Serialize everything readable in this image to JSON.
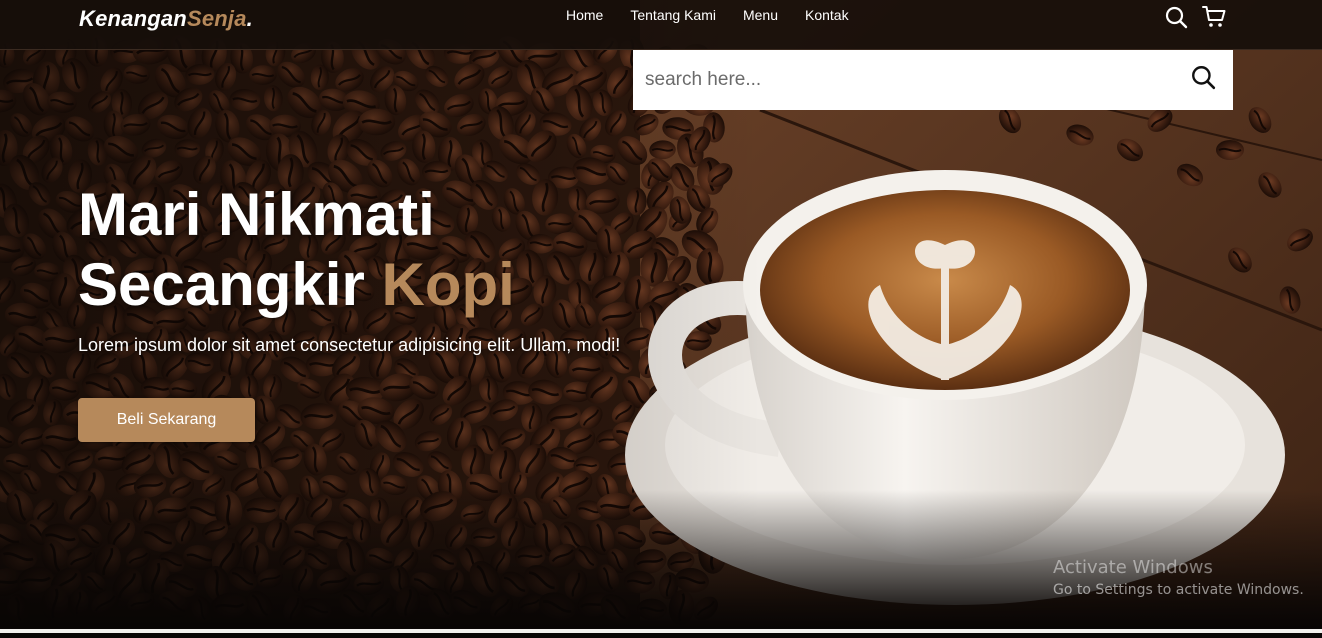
{
  "brand": {
    "name_main": "Kenangan",
    "name_accent": "Senja",
    "name_dot": "."
  },
  "nav": {
    "links": [
      "Home",
      "Tentang Kami",
      "Menu",
      "Kontak"
    ],
    "icons": [
      "search-icon",
      "cart-icon"
    ]
  },
  "search": {
    "placeholder": "search here...",
    "icon": "search-icon"
  },
  "hero": {
    "title_line1": "Mari Nikmati",
    "title_line2_main": "Secangkir ",
    "title_line2_accent": "Kopi",
    "description": "Lorem ipsum dolor sit amet consectetur adipisicing elit. Ullam, modi!",
    "cta_label": "Beli Sekarang"
  },
  "watermark": {
    "title": "Activate Windows",
    "subtitle": "Go to Settings to activate Windows."
  },
  "colors": {
    "accent": "#b6895b",
    "navbar_bg": "#160e0a",
    "text": "#ffffff",
    "search_bg": "#ffffff"
  }
}
